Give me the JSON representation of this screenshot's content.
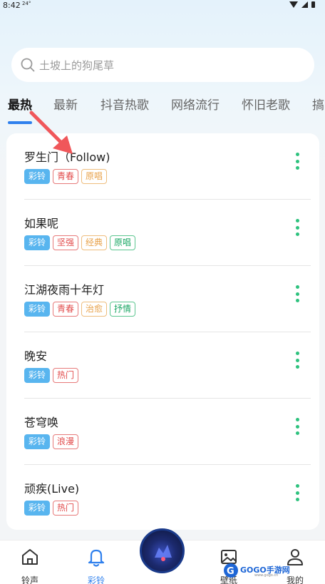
{
  "status_bar": {
    "time": "8:42",
    "temp": "24°"
  },
  "search": {
    "placeholder": "土坡上的狗尾草"
  },
  "tabs": [
    {
      "label": "最热",
      "active": true
    },
    {
      "label": "最新"
    },
    {
      "label": "抖音热歌"
    },
    {
      "label": "网络流行"
    },
    {
      "label": "怀旧老歌"
    },
    {
      "label": "搞"
    }
  ],
  "songs": [
    {
      "title": "罗生门（Follow)",
      "tags": [
        {
          "text": "彩铃",
          "color": "blue"
        },
        {
          "text": "青春",
          "color": "red"
        },
        {
          "text": "原唱",
          "color": "orange"
        }
      ]
    },
    {
      "title": "如果呢",
      "tags": [
        {
          "text": "彩铃",
          "color": "blue"
        },
        {
          "text": "坚强",
          "color": "red"
        },
        {
          "text": "经典",
          "color": "orange"
        },
        {
          "text": "原唱",
          "color": "green"
        }
      ]
    },
    {
      "title": "江湖夜雨十年灯",
      "tags": [
        {
          "text": "彩铃",
          "color": "blue"
        },
        {
          "text": "青春",
          "color": "red"
        },
        {
          "text": "治愈",
          "color": "orange"
        },
        {
          "text": "抒情",
          "color": "green"
        }
      ]
    },
    {
      "title": "晚安",
      "tags": [
        {
          "text": "彩铃",
          "color": "blue"
        },
        {
          "text": "热门",
          "color": "red"
        }
      ]
    },
    {
      "title": "苍穹唤",
      "tags": [
        {
          "text": "彩铃",
          "color": "blue"
        },
        {
          "text": "浪漫",
          "color": "red"
        }
      ]
    },
    {
      "title": "顽疾(Live)",
      "tags": [
        {
          "text": "彩铃",
          "color": "blue"
        },
        {
          "text": "热门",
          "color": "red"
        }
      ]
    }
  ],
  "bottom_nav": [
    {
      "label": "铃声",
      "icon": "home-icon"
    },
    {
      "label": "彩铃",
      "icon": "bell-icon",
      "active": true
    },
    {
      "label": "壁纸",
      "icon": "picture-icon"
    },
    {
      "label": "我的",
      "icon": "user-icon"
    }
  ],
  "watermark": {
    "text": "GOGO手游网",
    "sub": "www.gogo.cn"
  },
  "colors": {
    "accent": "#2f80ed",
    "more_dots": "#2ec27e",
    "annotation_arrow": "#f0575a"
  }
}
